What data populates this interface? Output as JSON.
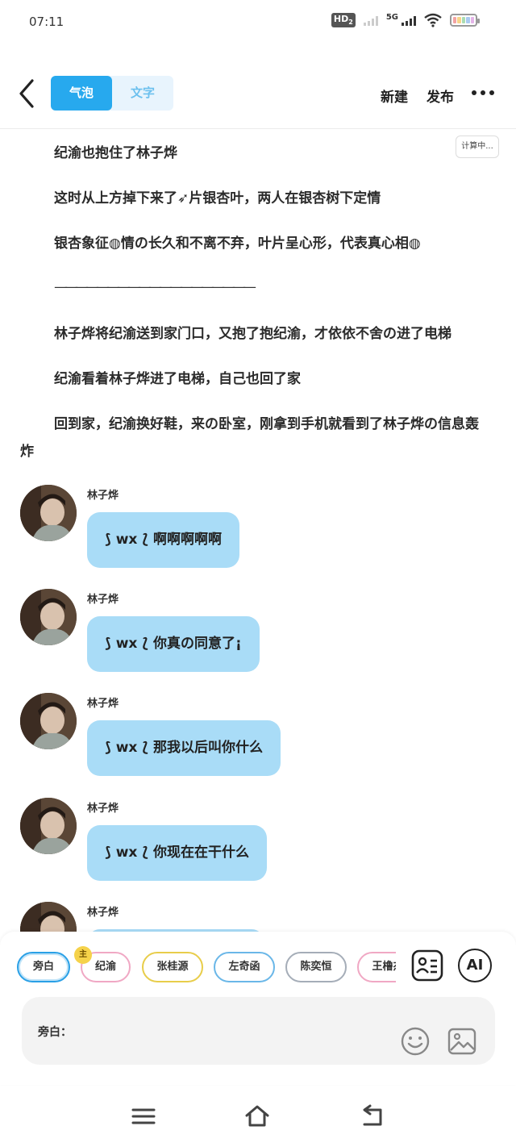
{
  "status": {
    "time": "07:11",
    "hd": "HD",
    "hd_sub": "2",
    "net": "5G"
  },
  "header": {
    "tabs": [
      {
        "label": "气泡",
        "active": true
      },
      {
        "label": "文字",
        "active": false
      }
    ],
    "new_label": "新建",
    "publish_label": "发布"
  },
  "content": {
    "calc_badge": "计算中...",
    "paragraphs": [
      "纪渝也抱住了林子烨",
      "这时从上方掉下来了➶片银杏叶，两人在银杏树下定情",
      "银杏象征◍情の长久和不离不弃，叶片呈心形，代表真心相◍",
      "———————————————————",
      "林子烨将纪渝送到家门口，又抱了抱纪渝，才依依不舍の进了电梯",
      "纪渝看着林子烨进了电梯，自己也回了家",
      "回到家，纪渝换好鞋，来の卧室，刚拿到手机就看到了林子烨の信息轰炸"
    ],
    "messages": [
      {
        "sender": "林子烨",
        "text": "⟆ wx ⟅ 啊啊啊啊啊"
      },
      {
        "sender": "林子烨",
        "text": "⟆ wx ⟅ 你真の同意了¡"
      },
      {
        "sender": "林子烨",
        "text": "⟆ wx ⟅ 那我以后叫你什么"
      },
      {
        "sender": "林子烨",
        "text": "⟆ wx ⟅ 你现在在干什么"
      },
      {
        "sender": "林子烨",
        "text": ""
      }
    ]
  },
  "composer": {
    "roles": [
      "旁白",
      "纪渝",
      "张桂源",
      "左奇函",
      "陈奕恒",
      "王橹杰"
    ],
    "main_badge": "主",
    "ai_label": "AI",
    "input_label": "旁白：",
    "input_value": ""
  },
  "colors": {
    "accent": "#27a9ee",
    "bubble": "#a9dcf7",
    "tab_bg": "#e8f4fd"
  }
}
